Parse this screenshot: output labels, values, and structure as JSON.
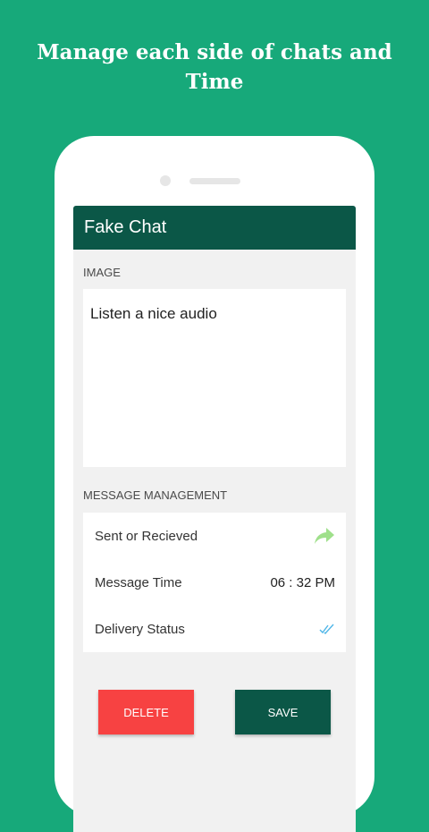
{
  "promo": {
    "title": "Manage each side of chats and Time"
  },
  "app": {
    "title": "Fake Chat"
  },
  "image_section": {
    "label": "IMAGE",
    "content": "Listen a nice audio"
  },
  "message_management": {
    "label": "MESSAGE MANAGEMENT",
    "rows": [
      {
        "label": "Sent or Recieved",
        "icon": "forward-arrow-icon"
      },
      {
        "label": "Message Time",
        "value": "06 : 32 PM"
      },
      {
        "label": "Delivery Status",
        "icon": "double-check-icon"
      }
    ]
  },
  "buttons": {
    "delete": "DELETE",
    "save": "SAVE"
  },
  "colors": {
    "background": "#17a97a",
    "appbar": "#0b5747",
    "delete": "#f74242",
    "save": "#0b5747",
    "arrow": "#9fe08b",
    "check": "#4fb6e8"
  }
}
